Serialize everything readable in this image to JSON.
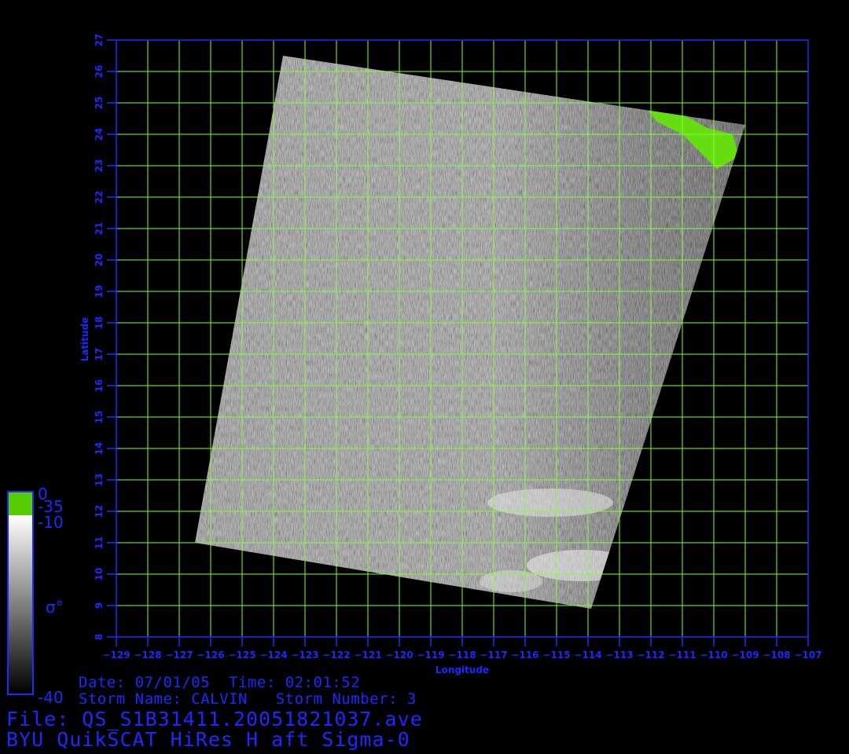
{
  "map": {
    "lon_ticks": [
      -129,
      -128,
      -127,
      -126,
      -125,
      -124,
      -123,
      -122,
      -121,
      -120,
      -119,
      -118,
      -117,
      -116,
      -115,
      -114,
      -113,
      -112,
      -111,
      -110,
      -109,
      -108,
      -107
    ],
    "lat_ticks": [
      8,
      9,
      10,
      11,
      12,
      13,
      14,
      15,
      16,
      17,
      18,
      19,
      20,
      21,
      22,
      23,
      24,
      25,
      26,
      27
    ],
    "lon_range": [
      -129,
      -107
    ],
    "lat_range": [
      8,
      27
    ],
    "xlabel": "Longitude",
    "ylabel": "Latitude",
    "grid_color": "#7fff3a",
    "frame_color": "#1a2bff",
    "swath_corners_lonlat": [
      [
        -123.7,
        26.5
      ],
      [
        -109.0,
        24.3
      ],
      [
        -113.9,
        8.9
      ],
      [
        -126.5,
        11.0
      ]
    ],
    "land_color": "#66dd11"
  },
  "colorbar": {
    "labels": [
      "0",
      "-35",
      "-10",
      "-40"
    ],
    "symbol": "σ°",
    "colors": {
      "top": "#55cc00",
      "light": "#ffffff",
      "dark": "#000000",
      "border": "#1a2bff"
    }
  },
  "footer": {
    "date_line": "Date: 07/01/05  Time: 02:01:52",
    "storm_line": "Storm Name: CALVIN   Storm Number: 3",
    "file_line": "File: QS_S1B31411.20051821037.ave",
    "product_line": "BYU QuikSCAT HiRes H aft Sigma-0"
  }
}
